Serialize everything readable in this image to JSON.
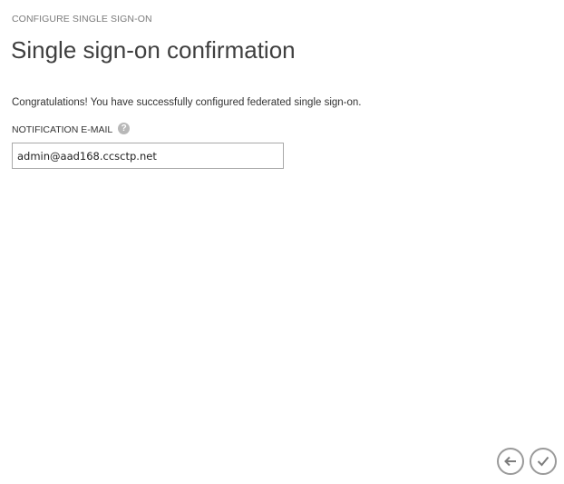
{
  "dialog": {
    "section_label": "CONFIGURE SINGLE SIGN-ON",
    "title": "Single sign-on confirmation",
    "message": "Congratulations! You have successfully configured federated single sign-on.",
    "notification_email": {
      "label": "NOTIFICATION E-MAIL",
      "help_icon": "?",
      "value": "admin@aad168.ccsctp.net"
    }
  },
  "footer": {
    "back_icon": "arrow-left-icon",
    "confirm_icon": "checkmark-icon"
  },
  "colors": {
    "text_primary": "#3f3f3f",
    "text_muted": "#7a7a7a",
    "border": "#a9a9a9",
    "button_outline": "#9a9a9a"
  }
}
